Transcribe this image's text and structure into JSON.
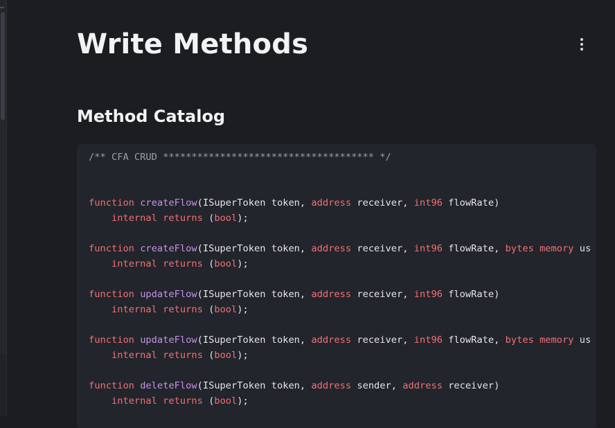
{
  "page": {
    "title": "Write Methods",
    "section_title": "Method Catalog",
    "more_menu_icon": "kebab-vertical-icon"
  },
  "colors": {
    "background": "#1b1d21",
    "code_background": "#22252b",
    "keyword": "#f07178",
    "function_name": "#c792ea",
    "comment": "#9aa0a8",
    "text": "#e4e6ea"
  },
  "code": {
    "comment": "/** CFA CRUD ************************************* */",
    "lines": [
      {
        "kw": "function",
        "fn": "createFlow",
        "p1": "(ISuperToken token, ",
        "t1": "address",
        "p2": " receiver, ",
        "t2": "int96",
        "p3": " flowRate)",
        "t3": "",
        "p4": "",
        "t4": "",
        "p5": ""
      },
      {
        "kw": "function",
        "fn": "createFlow",
        "p1": "(ISuperToken token, ",
        "t1": "address",
        "p2": " receiver, ",
        "t2": "int96",
        "p3": " flowRate, ",
        "t3": "bytes",
        "p4": " ",
        "t4": "memory",
        "p5": " us"
      },
      {
        "kw": "function",
        "fn": "updateFlow",
        "p1": "(ISuperToken token, ",
        "t1": "address",
        "p2": " receiver, ",
        "t2": "int96",
        "p3": " flowRate)",
        "t3": "",
        "p4": "",
        "t4": "",
        "p5": ""
      },
      {
        "kw": "function",
        "fn": "updateFlow",
        "p1": "(ISuperToken token, ",
        "t1": "address",
        "p2": " receiver, ",
        "t2": "int96",
        "p3": " flowRate, ",
        "t3": "bytes",
        "p4": " ",
        "t4": "memory",
        "p5": " us"
      },
      {
        "kw": "function",
        "fn": "deleteFlow",
        "p1": "(ISuperToken token, ",
        "t1": "address",
        "p2": " sender, ",
        "t2": "address",
        "p3": " receiver)",
        "t3": "",
        "p4": "",
        "t4": "",
        "p5": ""
      }
    ],
    "tail": {
      "indent": "    ",
      "kw1": "internal",
      "sp": " ",
      "kw2": "returns",
      "open": " (",
      "type": "bool",
      "close": ");"
    }
  }
}
